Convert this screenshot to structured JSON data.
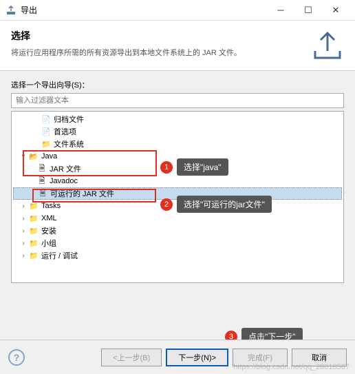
{
  "titlebar": {
    "title": "导出"
  },
  "header": {
    "title": "选择",
    "desc": "将运行应用程序所需的所有资源导出到本地文件系统上的 JAR 文件。"
  },
  "content": {
    "wizard_label": "选择一个导出向导(S)：",
    "filter_placeholder": "输入过滤器文本"
  },
  "tree": {
    "items": [
      {
        "label": "归档文件"
      },
      {
        "label": "首选项"
      },
      {
        "label": "文件系统"
      },
      {
        "label": "Java"
      },
      {
        "label": "JAR 文件"
      },
      {
        "label": "Javadoc"
      },
      {
        "label": "可运行的 JAR 文件"
      },
      {
        "label": "Tasks"
      },
      {
        "label": "XML"
      },
      {
        "label": "安装"
      },
      {
        "label": "小组"
      },
      {
        "label": "运行 / 调试"
      }
    ]
  },
  "callouts": {
    "c1": {
      "num": "1",
      "text": "选择\"java\""
    },
    "c2": {
      "num": "2",
      "text": "选择\"可运行的jar文件\""
    },
    "c3": {
      "num": "3",
      "text": "点击\"下一步\""
    }
  },
  "footer": {
    "back": "<上一步(B)",
    "next": "下一步(N)>",
    "finish": "完成(F)",
    "cancel": "取消"
  },
  "watermark": "https://blog.csdn.net/qq_28018587"
}
